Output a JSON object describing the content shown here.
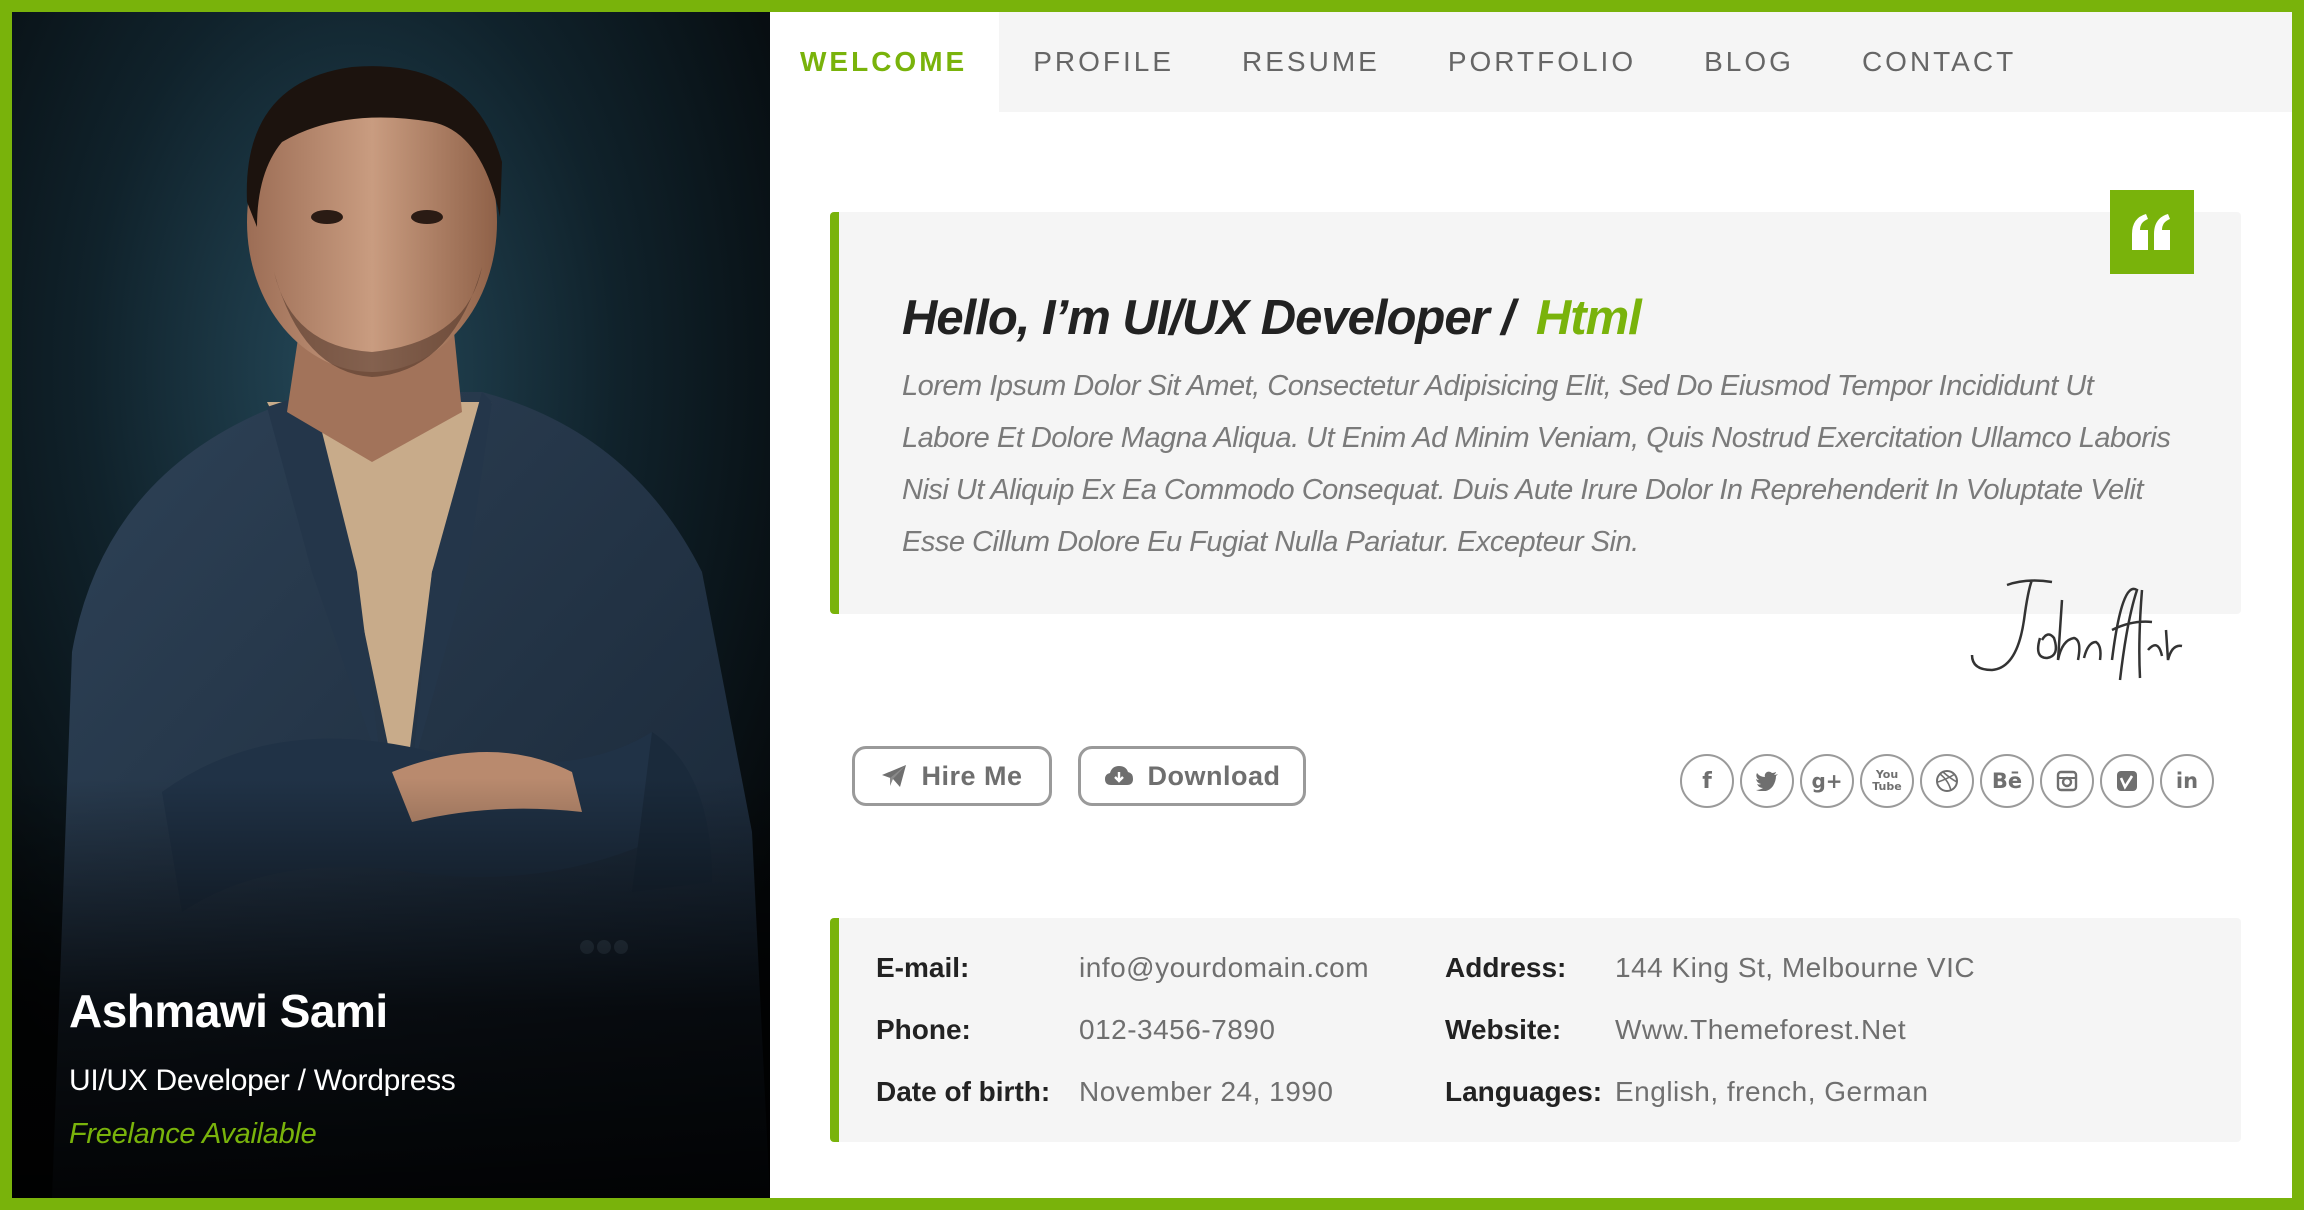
{
  "profile": {
    "name": "Ashmawi Sami",
    "role": "UI/UX Developer / Wordpress",
    "status": "Freelance Available"
  },
  "nav": {
    "items": [
      {
        "label": "WELCOME",
        "active": true
      },
      {
        "label": "PROFILE",
        "active": false
      },
      {
        "label": "RESUME",
        "active": false
      },
      {
        "label": "PORTFOLIO",
        "active": false
      },
      {
        "label": "BLOG",
        "active": false
      },
      {
        "label": "CONTACT",
        "active": false
      }
    ]
  },
  "intro": {
    "headline": "Hello, I’m UI/UX Developer /",
    "headline_accent": "Html",
    "bio": "Lorem Ipsum Dolor Sit Amet, Consectetur Adipisicing Elit, Sed Do Eiusmod Tempor Incididunt Ut Labore Et Dolore Magna Aliqua. Ut Enim Ad Minim Veniam, Quis Nostrud Exercitation Ullamco Laboris Nisi Ut Aliquip Ex Ea Commodo Consequat. Duis Aute Irure Dolor In Reprehenderit In Voluptate Velit Esse Cillum Dolore Eu Fugiat Nulla Pariatur. Excepteur Sin.",
    "signature": "John Hunt"
  },
  "actions": {
    "hire_label": "Hire Me",
    "download_label": "Download"
  },
  "social": [
    "facebook-icon",
    "twitter-icon",
    "google-plus-icon",
    "youtube-icon",
    "dribbble-icon",
    "behance-icon",
    "instagram-icon",
    "vimeo-icon",
    "linkedin-icon"
  ],
  "info": {
    "email_label": "E-mail:",
    "email_value": "info@yourdomain.com",
    "phone_label": "Phone:",
    "phone_value": "012-3456-7890",
    "dob_label": "Date of birth:",
    "dob_value": "November 24, 1990",
    "address_label": "Address:",
    "address_value": "144 King St, Melbourne VIC",
    "website_label": "Website:",
    "website_value": "Www.Themeforest.Net",
    "languages_label": "Languages:",
    "languages_value": "English, french, German"
  },
  "colors": {
    "accent": "#79b30b",
    "panel": "#f5f5f5",
    "text_dark": "#222222",
    "text_muted": "#6f6f6f"
  }
}
